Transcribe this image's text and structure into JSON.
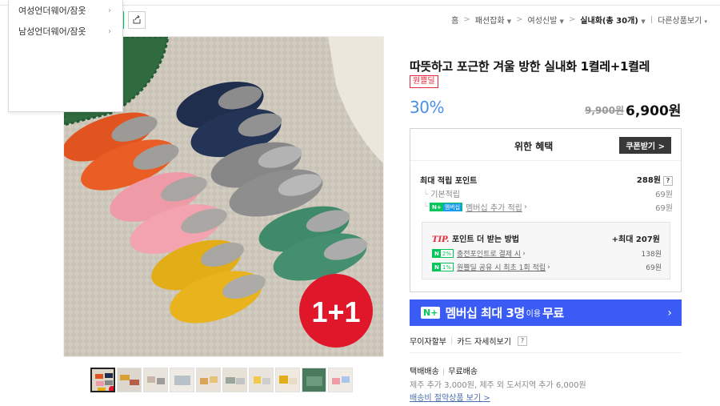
{
  "dropdown": {
    "items": [
      {
        "label": "여성언더웨어/잠옷"
      },
      {
        "label": "남성언더웨어/잠옷"
      }
    ]
  },
  "breadcrumb": {
    "items": [
      "홈",
      "패션잡화",
      "여성신발",
      "실내화(총 30개)"
    ],
    "more": "다른상품보기"
  },
  "product": {
    "title": "따뜻하고 포근한 겨울 방한 실내화 1켤레+1켤레",
    "badge": "원쁠딜",
    "image_text": "1+1",
    "discount": "30%",
    "original_price": "9,900원",
    "sale_price": "6,900원"
  },
  "benefit": {
    "title": "위한 혜택",
    "coupon_button": "쿠폰받기 >",
    "max_points_label": "최대 적립 포인트",
    "max_points_value": "288원",
    "help_mark": "?",
    "basic_label": "기본적립",
    "basic_value": "69원",
    "member_badge_n": "N+",
    "member_badge_text": "멤버십",
    "member_label": "멤버십 추가 적립",
    "member_value": "69원",
    "tip": {
      "tip_word": "TIP.",
      "title": "포인트 더 받는 방법",
      "max": "+최대 207원",
      "rows": [
        {
          "pct": "2%",
          "label": "충전포인트로 결제 시",
          "value": "138원"
        },
        {
          "pct": "1%",
          "label": "원쁠딜 공유 시 최초 1회 적립",
          "value": "69원"
        }
      ]
    }
  },
  "banner": {
    "badge": "N+",
    "text1": "멤버십 최대 3명",
    "text2": "이용",
    "text3": "무료",
    "arrow": "›"
  },
  "installment": {
    "label1": "무이자할부",
    "label2": "카드 자세히보기",
    "help": "?"
  },
  "shipping": {
    "type": "택배배송",
    "fee": "무료배송",
    "extra": "제주 추가 3,000원, 제주 외 도서지역 추가 6,000원",
    "link": "배송비 절약상품 보기 >"
  },
  "colors": {
    "accent_green": "#03c75a",
    "discount_blue": "#4a90e2",
    "badge_red": "#e8273a",
    "banner_blue": "#3b5bf5"
  }
}
